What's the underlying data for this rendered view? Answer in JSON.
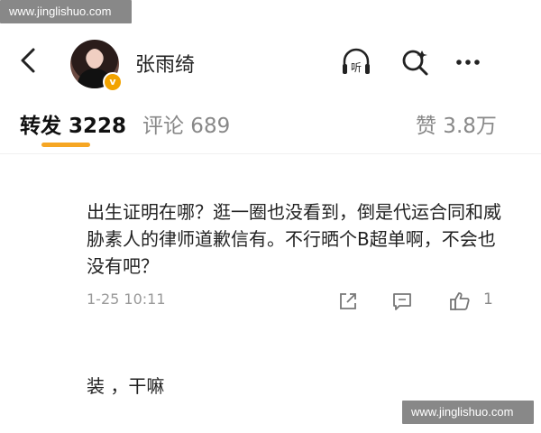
{
  "watermark": {
    "text": "www.jinglishuo.com"
  },
  "header": {
    "username": "张雨绮",
    "verified_badge": "v",
    "listen_label": "听",
    "icons": [
      "back-arrow-icon",
      "listen-headphones-icon",
      "search-icon",
      "more-icon"
    ]
  },
  "tabs": [
    {
      "label": "转发 3228",
      "active": true
    },
    {
      "label": "评论 689",
      "active": false
    },
    {
      "label": "赞 3.8万",
      "active": false
    }
  ],
  "comment": {
    "text": "出生证明在哪？逛一圈也没看到，倒是代运合同和威胁素人的律师道歉信有。不行晒个B超单啊，不会也没有吧？",
    "time": "1-25 10:11",
    "like_count": "1"
  },
  "next_comment": {
    "text": "装 ，干嘛"
  },
  "colors": {
    "accent": "#f6a623",
    "badge": "#f2a300"
  }
}
